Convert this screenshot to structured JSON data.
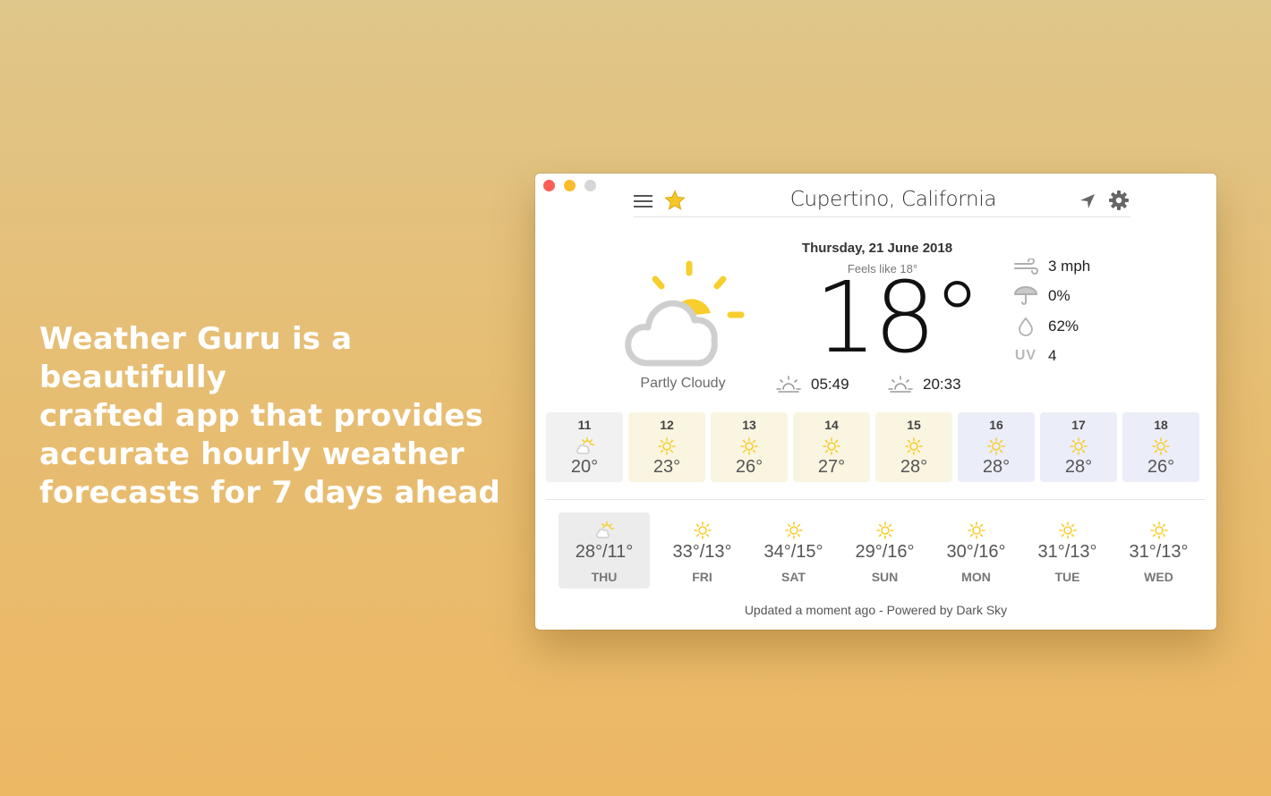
{
  "promo": {
    "line1": "Weather Guru is a beautifully",
    "line2": "crafted app that provides",
    "line3": "accurate hourly weather",
    "line4": "forecasts for 7 days ahead"
  },
  "toolbar": {
    "location": "Cupertino, California",
    "icons": [
      "menu-icon",
      "star-icon",
      "location-arrow-icon",
      "gear-icon"
    ]
  },
  "current": {
    "date": "Thursday, 21 June 2018",
    "feels_like": "Feels like 18°",
    "temperature": "18°",
    "condition": "Partly Cloudy",
    "sunrise": "05:49",
    "sunset": "20:33",
    "wind": "3 mph",
    "precipitation": "0%",
    "humidity": "62%",
    "uv_label": "UV",
    "uv": "4"
  },
  "hourly": [
    {
      "hour": "11",
      "temp": "20°",
      "icon": "partly-cloudy-icon",
      "bg": "#f1f1f1"
    },
    {
      "hour": "12",
      "temp": "23°",
      "icon": "sun-icon",
      "bg": "#f9f5e1"
    },
    {
      "hour": "13",
      "temp": "26°",
      "icon": "sun-icon",
      "bg": "#f9f5e1"
    },
    {
      "hour": "14",
      "temp": "27°",
      "icon": "sun-icon",
      "bg": "#f9f5e1"
    },
    {
      "hour": "15",
      "temp": "28°",
      "icon": "sun-icon",
      "bg": "#f9f5e1"
    },
    {
      "hour": "16",
      "temp": "28°",
      "icon": "sun-icon",
      "bg": "#ebedf8"
    },
    {
      "hour": "17",
      "temp": "28°",
      "icon": "sun-icon",
      "bg": "#ebedf8"
    },
    {
      "hour": "18",
      "temp": "26°",
      "icon": "sun-icon",
      "bg": "#ebedf8"
    }
  ],
  "daily": [
    {
      "day": "THU",
      "range": "28°/11°",
      "icon": "partly-cloudy-icon",
      "selected": true
    },
    {
      "day": "FRI",
      "range": "33°/13°",
      "icon": "sun-icon"
    },
    {
      "day": "SAT",
      "range": "34°/15°",
      "icon": "sun-icon"
    },
    {
      "day": "SUN",
      "range": "29°/16°",
      "icon": "sun-icon"
    },
    {
      "day": "MON",
      "range": "30°/16°",
      "icon": "sun-icon"
    },
    {
      "day": "TUE",
      "range": "31°/13°",
      "icon": "sun-icon"
    },
    {
      "day": "WED",
      "range": "31°/13°",
      "icon": "sun-icon"
    }
  ],
  "footer": "Updated a moment ago - Powered by Dark Sky",
  "colors": {
    "sun": "#f7ce2c",
    "cloud": "#cfcfcf",
    "hourly_warm": "#f9f5e1",
    "hourly_cool": "#ebedf8",
    "hourly_now": "#f1f1f1"
  }
}
